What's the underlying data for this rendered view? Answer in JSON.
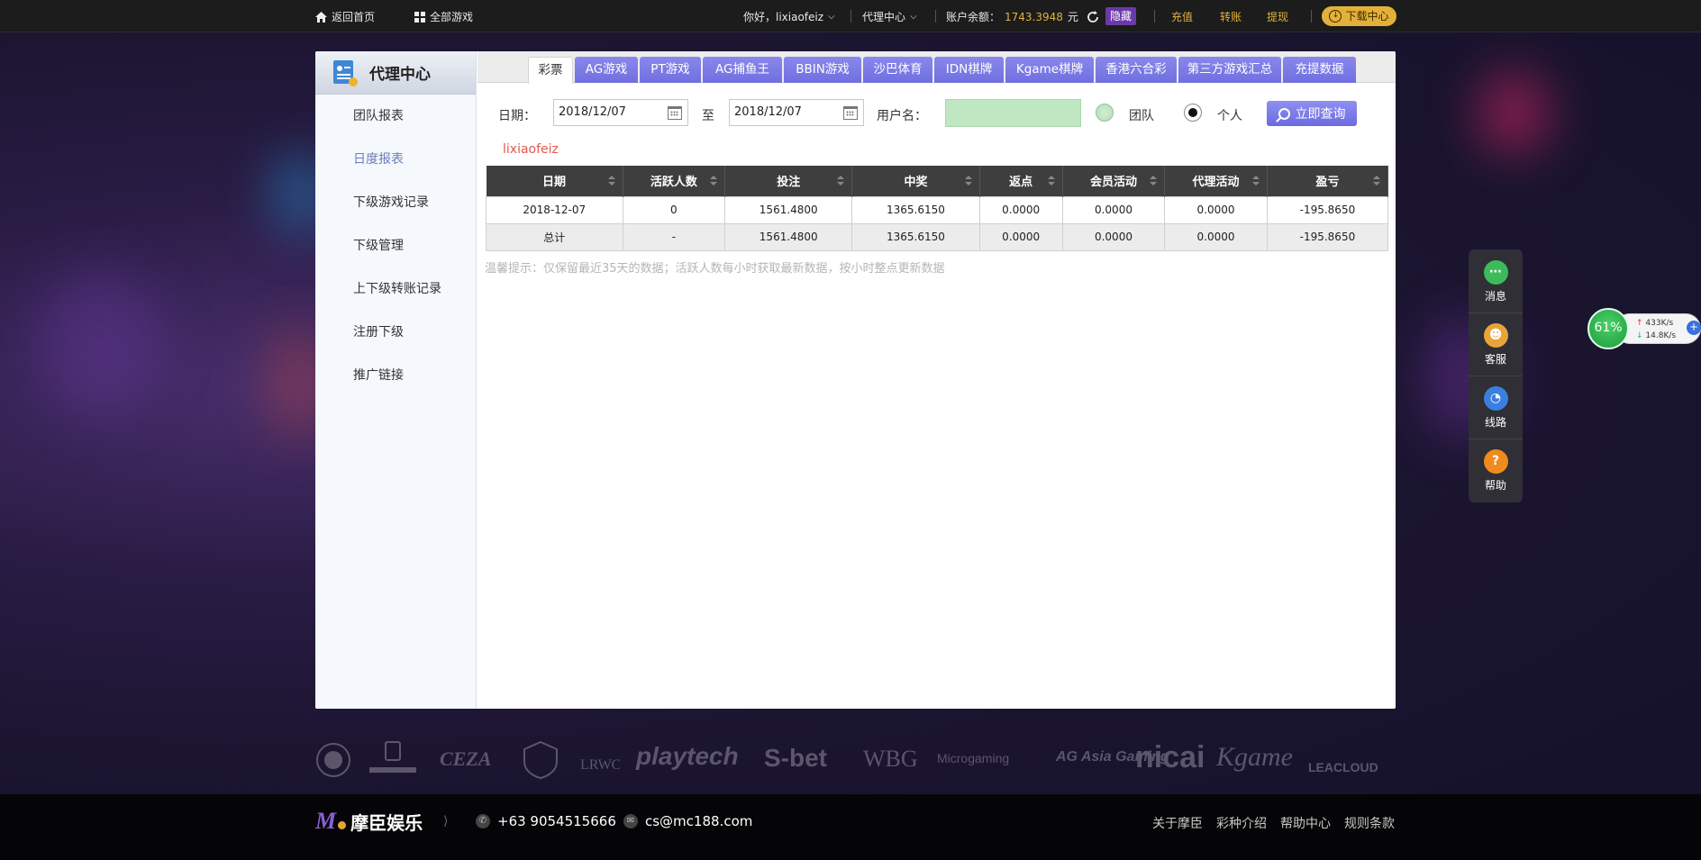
{
  "topbar": {
    "home": "返回首页",
    "all_games": "全部游戏",
    "greeting": "你好，lixiaofeiz",
    "agent_center": "代理中心",
    "balance_label": "账户余额：",
    "balance_value": "1743.3948",
    "balance_unit": "元",
    "hide": "隐藏",
    "recharge": "充值",
    "transfer": "转账",
    "withdraw": "提现",
    "download": "下载中心"
  },
  "sidebar": {
    "title": "代理中心",
    "items": [
      {
        "label": "团队报表",
        "active": false
      },
      {
        "label": "日度报表",
        "active": true
      },
      {
        "label": "下级游戏记录",
        "active": false
      },
      {
        "label": "下级管理",
        "active": false
      },
      {
        "label": "上下级转账记录",
        "active": false
      },
      {
        "label": "注册下级",
        "active": false
      },
      {
        "label": "推广链接",
        "active": false
      }
    ]
  },
  "tabs": [
    {
      "label": "彩票",
      "active": true
    },
    {
      "label": "AG游戏",
      "active": false
    },
    {
      "label": "PT游戏",
      "active": false
    },
    {
      "label": "AG捕鱼王",
      "active": false
    },
    {
      "label": "BBIN游戏",
      "active": false
    },
    {
      "label": "沙巴体育",
      "active": false
    },
    {
      "label": "IDN棋牌",
      "active": false
    },
    {
      "label": "Kgame棋牌",
      "active": false
    },
    {
      "label": "香港六合彩",
      "active": false
    },
    {
      "label": "第三方游戏汇总",
      "active": false
    },
    {
      "label": "充提数据",
      "active": false
    }
  ],
  "filter": {
    "date_label": "日期：",
    "start_date": "2018/12/07",
    "to_label": "至",
    "end_date": "2018/12/07",
    "username_label": "用户名：",
    "username_value": "",
    "team_label": "团队",
    "team_selected": false,
    "personal_label": "个人",
    "personal_selected": true,
    "query_button": "立即查询"
  },
  "current_user": "lixiaofeiz",
  "table": {
    "columns": [
      "日期",
      "活跃人数",
      "投注",
      "中奖",
      "返点",
      "会员活动",
      "代理活动",
      "盈亏"
    ],
    "rows": [
      [
        "2018-12-07",
        "0",
        "1561.4800",
        "1365.6150",
        "0.0000",
        "0.0000",
        "0.0000",
        "-195.8650"
      ]
    ],
    "total": [
      "总计",
      "-",
      "1561.4800",
      "1365.6150",
      "0.0000",
      "0.0000",
      "0.0000",
      "-195.8650"
    ]
  },
  "tip": "温馨提示：仅保留最近35天的数据；活跃人数每小时获取最新数据，按小时整点更新数据",
  "float_panel": [
    {
      "label": "消息",
      "icon": "chat-icon",
      "color": "#3dbb5a"
    },
    {
      "label": "客服",
      "icon": "service-agent-icon",
      "color": "#e8a33a"
    },
    {
      "label": "线路",
      "icon": "speedometer-icon",
      "color": "#3a7fe0"
    },
    {
      "label": "帮助",
      "icon": "help-icon",
      "color": "#f08a1e"
    }
  ],
  "net_widget": {
    "percent": "61%",
    "upload": "433K/s",
    "download": "14.8K/s"
  },
  "partner_logos": [
    "CEZA",
    "playtech",
    "S-bet",
    "WBG",
    "Microgaming",
    "AG Asia Gaming",
    "nicai",
    "Kgame",
    "LEACLOUD"
  ],
  "footer": {
    "brand_name": "摩臣娱乐",
    "phone": "+63 9054515666",
    "email": "cs@mc188.com",
    "links": [
      "关于摩臣",
      "彩种介绍",
      "帮助中心",
      "规则条款"
    ]
  },
  "colors": {
    "accent": "#7474e6",
    "gold": "#e0b23f",
    "negative": "#e05a4e"
  }
}
